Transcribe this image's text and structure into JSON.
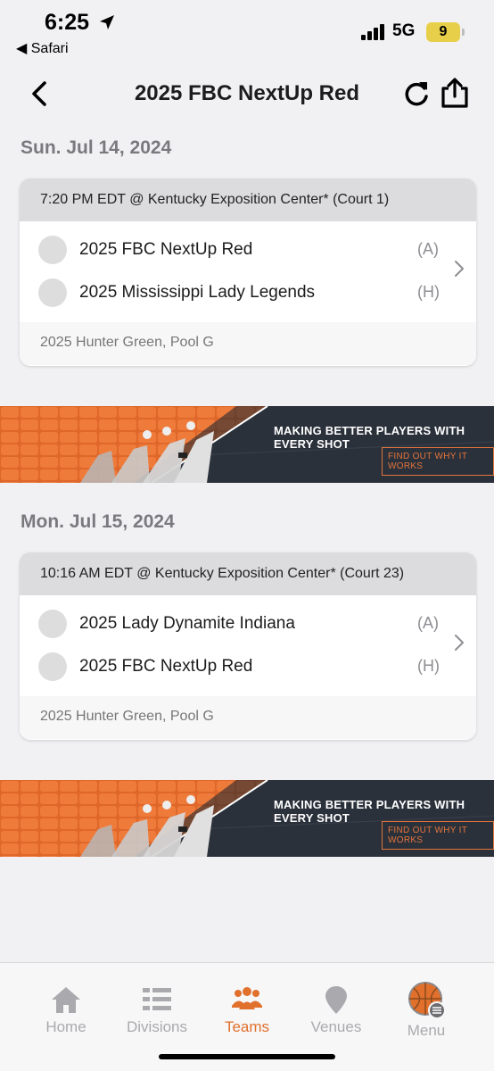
{
  "status_bar": {
    "time": "6:25",
    "back_app": "◀ Safari",
    "network": "5G",
    "battery": "9"
  },
  "nav": {
    "title": "2025 FBC NextUp Red"
  },
  "days": [
    {
      "date": "Sun. Jul 14, 2024",
      "game": {
        "header": "7:20 PM EDT @ Kentucky Exposition Center* (Court 1)",
        "teams": [
          {
            "name": "2025 FBC NextUp Red",
            "side": "(A)"
          },
          {
            "name": "2025 Mississippi Lady Legends",
            "side": "(H)"
          }
        ],
        "footer": "2025 Hunter Green, Pool G"
      }
    },
    {
      "date": "Mon. Jul 15, 2024",
      "game": {
        "header": "10:16 AM EDT @ Kentucky Exposition Center* (Court 23)",
        "teams": [
          {
            "name": "2025 Lady Dynamite Indiana",
            "side": "(A)"
          },
          {
            "name": "2025 FBC NextUp Red",
            "side": "(H)"
          }
        ],
        "footer": "2025 Hunter Green, Pool G"
      }
    }
  ],
  "ad": {
    "headline": "MAKING BETTER PLAYERS WITH EVERY SHOT",
    "cta": "FIND OUT WHY IT WORKS"
  },
  "tabs": [
    {
      "label": "Home",
      "icon": "home-icon"
    },
    {
      "label": "Divisions",
      "icon": "divisions-icon"
    },
    {
      "label": "Teams",
      "icon": "teams-icon"
    },
    {
      "label": "Venues",
      "icon": "location-pin-icon"
    },
    {
      "label": "Menu",
      "icon": "basketball-menu-icon"
    }
  ],
  "colors": {
    "accent": "#e0702c",
    "inactive": "#aaaaae",
    "card_header": "#dcdcde",
    "background": "#f1f1f3",
    "battery": "#e8cf4a"
  }
}
